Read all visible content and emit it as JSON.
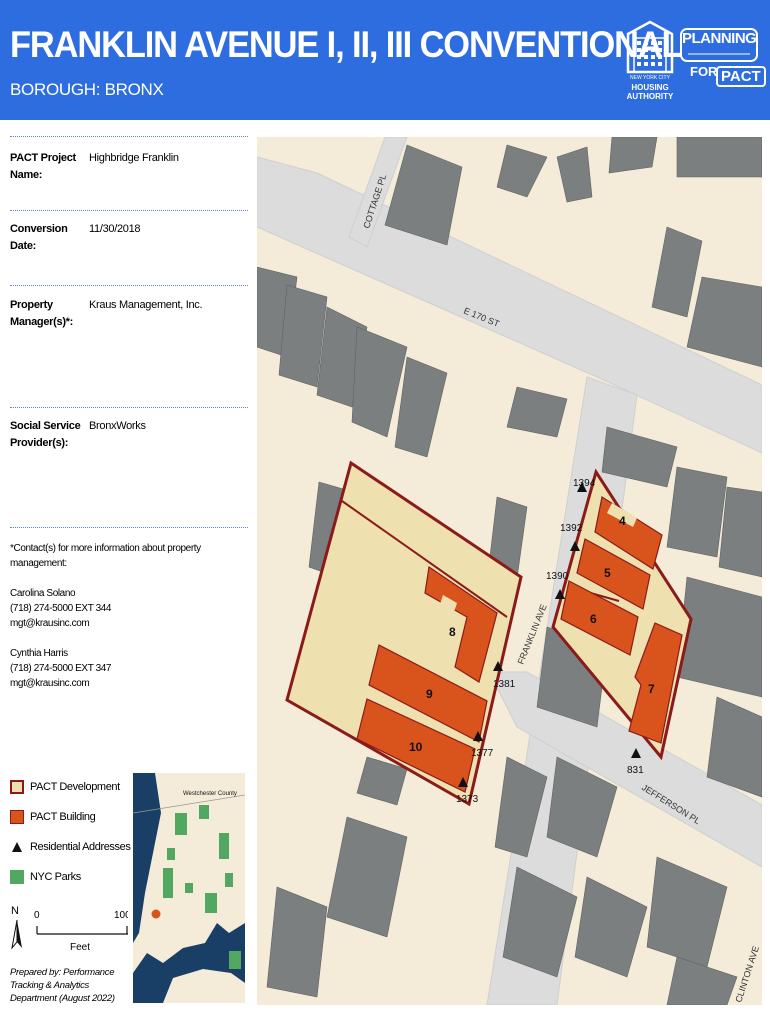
{
  "header": {
    "title": "FRANKLIN AVENUE I, II, III CONVENTIONAL",
    "borough": "BOROUGH: BRONX",
    "nycha_logo_text": [
      "NEW YORK CITY",
      "HOUSING",
      "AUTHORITY"
    ],
    "pact_logo_text": [
      "PLANNING",
      "FOR",
      "PACT"
    ]
  },
  "info": {
    "project_name_label": "PACT Project Name:",
    "project_name_value": "Highbridge Franklin",
    "conversion_date_label": "Conversion Date:",
    "conversion_date_value": "11/30/2018",
    "manager_label": "Property Manager(s)*:",
    "manager_value": "Kraus Management, Inc.",
    "social_label": "Social Service Provider(s):",
    "social_value": "BronxWorks"
  },
  "contacts": {
    "intro": "*Contact(s) for more information about property management:",
    "people": [
      {
        "name": "Carolina Solano",
        "phone": "(718) 274-5000 EXT 344",
        "email": "mgt@krausinc.com"
      },
      {
        "name": "Cynthia Harris",
        "phone": "(718) 274-5000 EXT 347",
        "email": "mgt@krausinc.com"
      }
    ]
  },
  "legend": {
    "items": [
      "PACT Development",
      "PACT Building",
      "Residential Addresses",
      "NYC Parks"
    ]
  },
  "scale": {
    "north": "N",
    "start": "0",
    "end": "100",
    "unit": "Feet"
  },
  "prepared_by": "Prepared by: Performance Tracking & Analytics Department (August 2022)",
  "inset": {
    "label": "Westchester County"
  },
  "map": {
    "streets": [
      "COTTAGE PL",
      "E 170 ST",
      "FRANKLIN AVE",
      "JEFFERSON PL",
      "CLINTON AVE"
    ],
    "buildings": [
      "4",
      "5",
      "6",
      "7",
      "8",
      "9",
      "10"
    ],
    "addresses": [
      "1394",
      "1392",
      "1390",
      "1381",
      "1377",
      "1373",
      "831"
    ]
  },
  "colors": {
    "banner": "#2d6ddf",
    "development_fill": "#efe0b0",
    "development_stroke": "#8b1a1a",
    "building_fill": "#d9541c",
    "block_fill": "#f4ecd8",
    "road": "#dcdcdc",
    "other_building": "#7b7f80",
    "park": "#52a860"
  }
}
